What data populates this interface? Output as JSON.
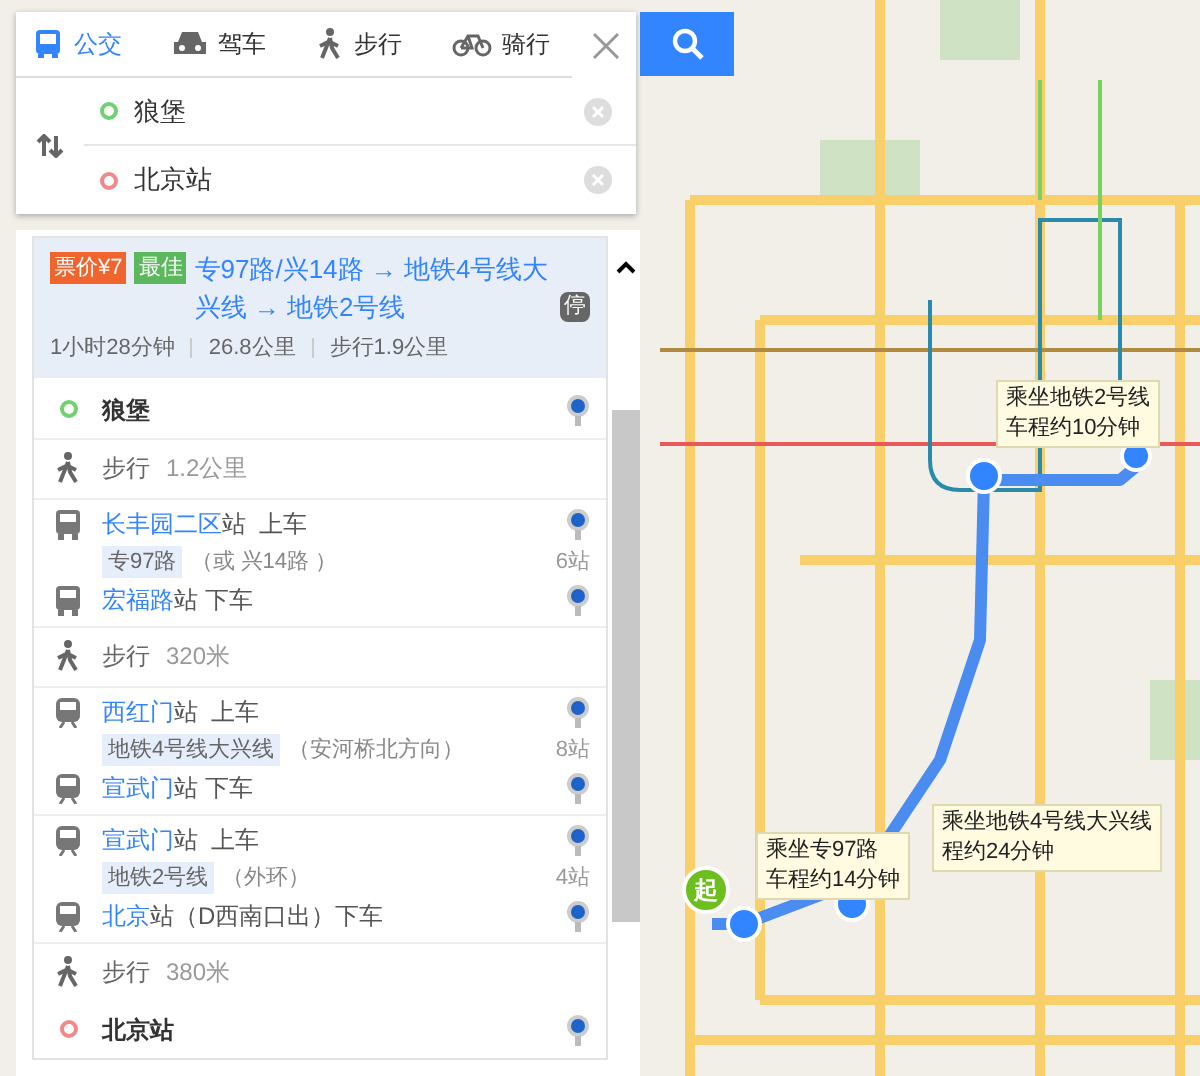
{
  "tabs": [
    {
      "label": "公交",
      "kind": "bus",
      "selected": true
    },
    {
      "label": "驾车",
      "kind": "car",
      "selected": false
    },
    {
      "label": "步行",
      "kind": "walk",
      "selected": false
    },
    {
      "label": "骑行",
      "kind": "bike",
      "selected": false
    }
  ],
  "inputs": [
    {
      "kind": "start",
      "value": "狼堡"
    },
    {
      "kind": "end",
      "value": "北京站"
    }
  ],
  "summary": {
    "badges": [
      {
        "text": "票价¥7",
        "color": "#f0652e"
      },
      {
        "text": "最佳",
        "color": "#5cb85c"
      }
    ],
    "route": "专97路/兴14路 → 地铁4号线大兴线 → 地铁2号线",
    "stop_badge": "停",
    "stats": [
      "1小时28分钟",
      "26.8公里",
      "步行1.9公里"
    ]
  },
  "steps": [
    {
      "kind": "start",
      "name": "狼堡"
    },
    {
      "kind": "walk",
      "label": "步行",
      "distance": "1.2公里"
    },
    {
      "kind": "bus_ride",
      "board": {
        "station": "长丰园二区",
        "action": "站  上车"
      },
      "line": {
        "name": "专97路",
        "note": "（或 兴14路 ）",
        "stops": "6站"
      },
      "alight": {
        "station": "宏福路",
        "action": "站 下车"
      }
    },
    {
      "kind": "walk",
      "label": "步行",
      "distance": "320米"
    },
    {
      "kind": "subway_ride",
      "board": {
        "station": "西红门",
        "action": "站  上车"
      },
      "line": {
        "name": "地铁4号线大兴线",
        "note": "（安河桥北方向）",
        "stops": "8站"
      },
      "alight": {
        "station": "宣武门",
        "action": "站 下车"
      }
    },
    {
      "kind": "subway_ride",
      "board": {
        "station": "宣武门",
        "action": "站  上车"
      },
      "line": {
        "name": "地铁2号线",
        "note": "（外环）",
        "stops": "4站"
      },
      "alight": {
        "station": "北京",
        "action": "站（D西南口出）下车"
      }
    },
    {
      "kind": "walk",
      "label": "步行",
      "distance": "380米"
    },
    {
      "kind": "end",
      "name": "北京站"
    }
  ],
  "map": {
    "callouts": [
      {
        "lines": [
          "乘坐地铁2号线",
          "车程约10分钟"
        ]
      },
      {
        "lines": [
          "乘坐地铁4号线大兴线",
          "程约24分钟"
        ]
      },
      {
        "lines": [
          "乘坐专97路",
          "车程约14分钟"
        ]
      }
    ],
    "start_marker": "起"
  }
}
